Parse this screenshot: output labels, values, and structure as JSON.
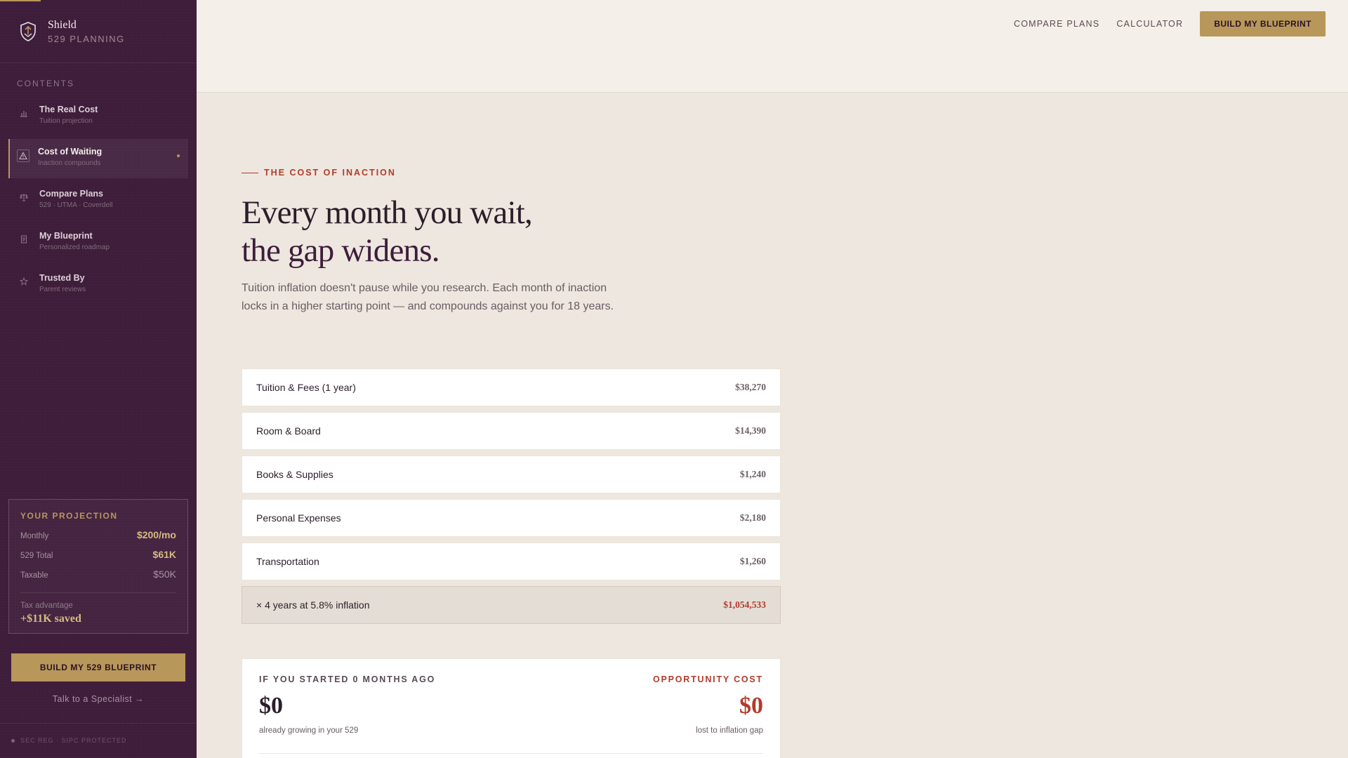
{
  "brand": {
    "name": "Shield",
    "subtitle": "529 PLANNING"
  },
  "sidebar": {
    "contents_label": "CONTENTS",
    "items": [
      {
        "title": "The Real Cost",
        "subtitle": "Tuition projection",
        "icon": "bar-chart-icon"
      },
      {
        "title": "Cost of Waiting",
        "subtitle": "Inaction compounds",
        "icon": "warning-triangle-icon",
        "active": true
      },
      {
        "title": "Compare Plans",
        "subtitle": "529 · UTMA · Coverdell",
        "icon": "scale-icon"
      },
      {
        "title": "My Blueprint",
        "subtitle": "Personalized roadmap",
        "icon": "document-icon"
      },
      {
        "title": "Trusted By",
        "subtitle": "Parent reviews",
        "icon": "star-icon"
      }
    ],
    "projection": {
      "title": "YOUR PROJECTION",
      "monthly_label": "Monthly",
      "monthly_value": "$200/mo",
      "total_label": "529 Total",
      "total_value": "$61K",
      "taxable_label": "Taxable",
      "taxable_value": "$50K",
      "advantage_label": "Tax advantage",
      "advantage_value": "+$11K saved"
    },
    "cta_label": "BUILD MY 529 BLUEPRINT",
    "specialist_label": "Talk to a Specialist →",
    "footer_text": "SEC REG · SIPC PROTECTED"
  },
  "topnav": {
    "compare_label": "COMPARE PLANS",
    "calculator_label": "CALCULATOR",
    "cta_label": "BUILD MY BLUEPRINT"
  },
  "hero": {
    "eyebrow": "THE COST OF INACTION",
    "headline_line1": "Every month you wait,",
    "headline_line2": "the gap widens.",
    "lead": "Tuition inflation doesn't pause while you research. Each month of inaction locks in a higher starting point — and compounds against you for 18 years."
  },
  "costs": [
    {
      "label": "Tuition & Fees (1 year)",
      "value": "$38,270"
    },
    {
      "label": "Room & Board",
      "value": "$14,390"
    },
    {
      "label": "Books & Supplies",
      "value": "$1,240"
    },
    {
      "label": "Personal Expenses",
      "value": "$2,180"
    },
    {
      "label": "Transportation",
      "value": "$1,260"
    }
  ],
  "cost_total": {
    "label": "× 4 years at 5.8% inflation",
    "value": "$1,054,533"
  },
  "opportunity": {
    "left_heading": "IF YOU STARTED 0 MONTHS AGO",
    "right_heading": "OPPORTUNITY COST",
    "left_value": "$0",
    "right_value": "$0",
    "left_note": "already growing in your 529",
    "right_note": "lost to inflation gap"
  },
  "colors": {
    "sidebar_bg": "#3e1d3b",
    "accent_gold": "#b8975a",
    "accent_red": "#b23b2c",
    "page_bg": "#ede7df"
  }
}
